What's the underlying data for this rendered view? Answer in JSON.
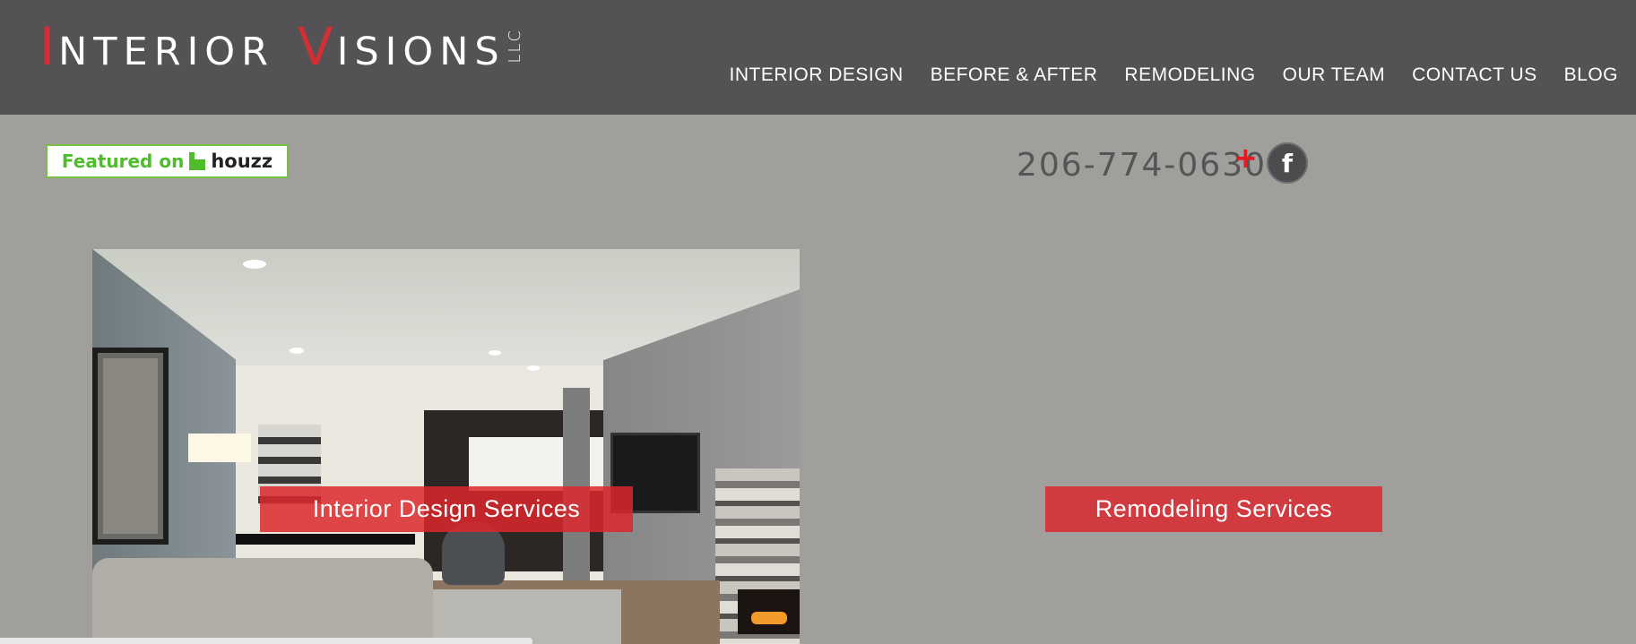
{
  "brand": {
    "name_first_initial": "I",
    "name_first_rest": "NTERIOR",
    "name_second_initial": "V",
    "name_second_rest": "ISIONS",
    "suffix": "LLC",
    "accent_color": "#d12f35"
  },
  "nav": {
    "items": [
      {
        "label": "INTERIOR DESIGN"
      },
      {
        "label": "BEFORE & AFTER"
      },
      {
        "label": "REMODELING"
      },
      {
        "label": "OUR TEAM"
      },
      {
        "label": "CONTACT US"
      },
      {
        "label": "BLOG"
      }
    ]
  },
  "houzz_badge": {
    "featured_text": "Featured on",
    "brand_text": "houzz",
    "icon": "houzz-h-icon",
    "color": "#4ebc2b"
  },
  "contact": {
    "phone": "206-774-0630",
    "plus": "+",
    "facebook_glyph": "f",
    "facebook_icon": "facebook-icon"
  },
  "services": {
    "interior_label": "Interior Design Services",
    "remodel_label": "Remodeling Services",
    "button_color": "#d13b3f"
  },
  "colors": {
    "header_bg": "#545254",
    "page_bg": "#a09f9b"
  }
}
